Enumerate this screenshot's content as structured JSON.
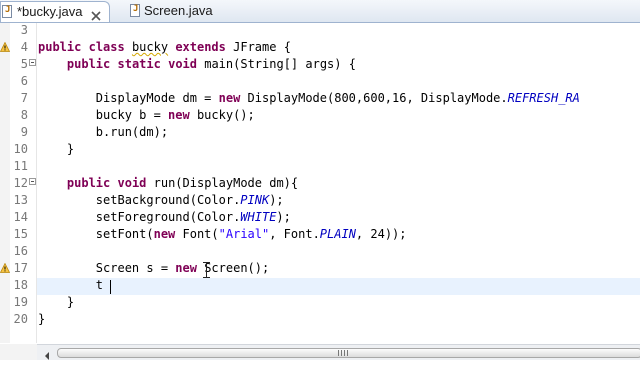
{
  "tabs": [
    {
      "label": "*bucky.java",
      "active": true,
      "icon": "java-file-icon"
    },
    {
      "label": "Screen.java",
      "active": false,
      "icon": "java-file-icon"
    }
  ],
  "colors": {
    "keyword": "#7f0055",
    "string": "#2a00ff",
    "constant": "#0000c0",
    "line_number": "#787878",
    "current_line": "#e8f2fe"
  },
  "editor": {
    "lines": [
      {
        "num": "3",
        "text": ""
      },
      {
        "num": "4",
        "text": "public class bucky extends JFrame {"
      },
      {
        "num": "5",
        "text": "    public static void main(String[] args) {"
      },
      {
        "num": "6",
        "text": ""
      },
      {
        "num": "7",
        "text": "        DisplayMode dm = new DisplayMode(800,600,16, DisplayMode.REFRESH_RA"
      },
      {
        "num": "8",
        "text": "        bucky b = new bucky();"
      },
      {
        "num": "9",
        "text": "        b.run(dm);"
      },
      {
        "num": "10",
        "text": "    }"
      },
      {
        "num": "11",
        "text": ""
      },
      {
        "num": "12",
        "text": "    public void run(DisplayMode dm){"
      },
      {
        "num": "13",
        "text": "        setBackground(Color.PINK);"
      },
      {
        "num": "14",
        "text": "        setForeground(Color.WHITE);"
      },
      {
        "num": "15",
        "text": "        setFont(new Font(\"Arial\", Font.PLAIN, 24));"
      },
      {
        "num": "16",
        "text": ""
      },
      {
        "num": "17",
        "text": "        Screen s = new Screen();"
      },
      {
        "num": "18",
        "text": "        t"
      },
      {
        "num": "19",
        "text": "    }"
      },
      {
        "num": "20",
        "text": "}"
      }
    ]
  }
}
